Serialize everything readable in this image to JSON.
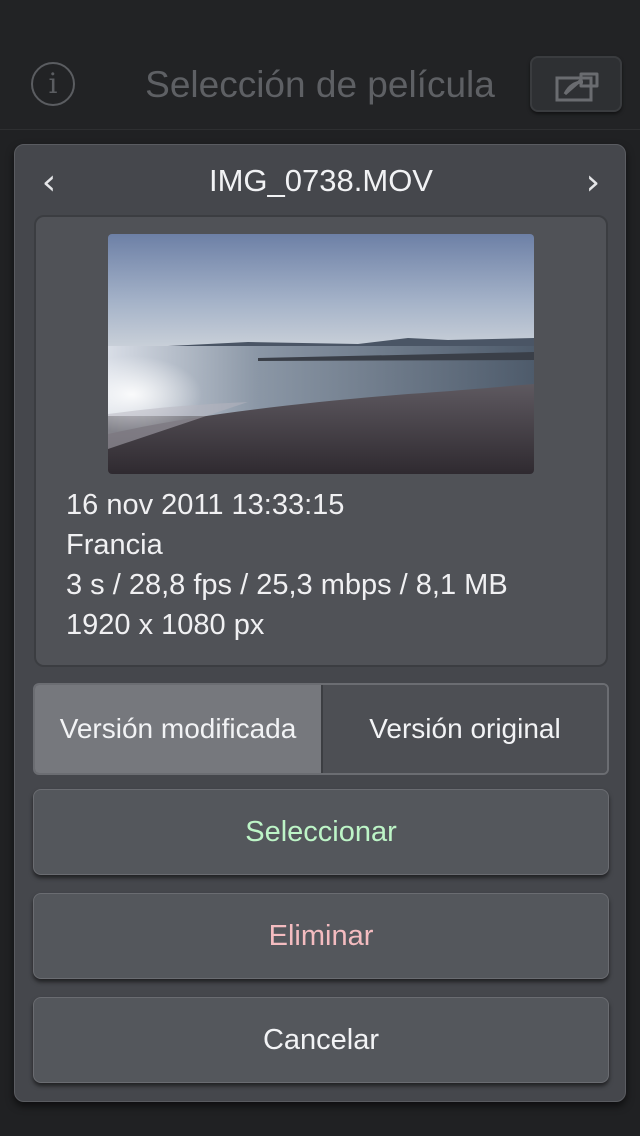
{
  "header": {
    "title": "Selección de película",
    "info_icon": "info-icon",
    "share_icon": "share-icon"
  },
  "panel": {
    "file_name": "IMG_0738.MOV",
    "prev_glyph": "‹",
    "next_glyph": "›"
  },
  "details": {
    "date": "16 nov 2011 13:33:15",
    "location": "Francia",
    "specs": "3 s / 28,8 fps / 25,3 mbps / 8,1 MB",
    "resolution": "1920 x 1080 px"
  },
  "version_toggle": {
    "modified_label": "Versión modificada",
    "original_label": "Versión original",
    "selected": "Versión modificada"
  },
  "actions": {
    "select_label": "Seleccionar",
    "delete_label": "Eliminar",
    "cancel_label": "Cancelar"
  },
  "colors": {
    "background": "#202123",
    "panel": "#45474c",
    "select_text": "#bdf5c7",
    "delete_text": "#f4bcc0"
  }
}
